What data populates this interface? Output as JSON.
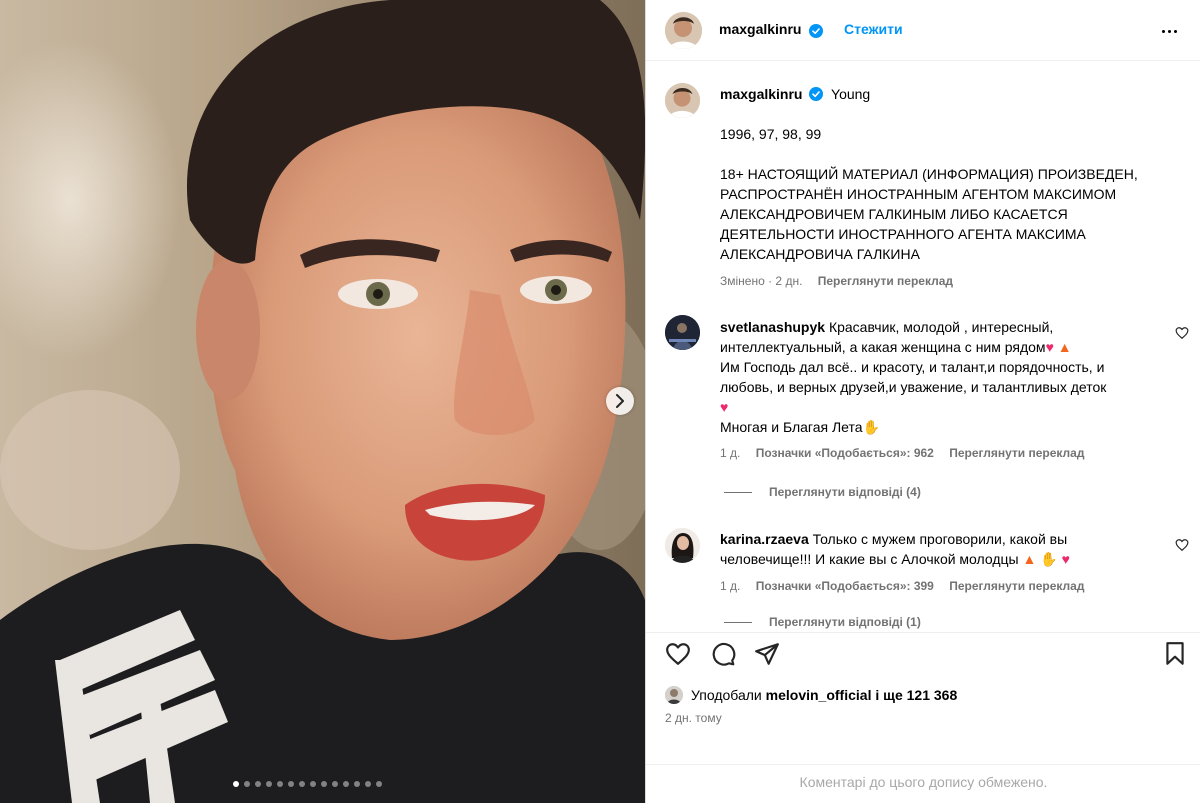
{
  "header": {
    "username": "maxgalkinru",
    "follow_label": "Стежити"
  },
  "caption": {
    "username": "maxgalkinru",
    "first_line": "Young",
    "years": "1996, 97, 98, 99",
    "notice": "18+ НАСТОЯЩИЙ МАТЕРИАЛ (ИНФОРМАЦИЯ) ПРОИЗВЕДЕН, РАСПРОСТРАНЁН ИНОСТРАННЫМ АГЕНТОМ МАКСИМОМ АЛЕКСАНДРОВИЧЕМ ГАЛКИНЫМ ЛИБО КАСАЕТСЯ ДЕЯТЕЛЬНОСТИ ИНОСТРАННОГО АГЕНТА МАКСИМА АЛЕКСАНДРОВИЧА ГАЛКИНА",
    "edited": "Змінено · 2 дн.",
    "translate": "Переглянути переклад"
  },
  "comments": [
    {
      "username": "svetlanashupyk",
      "text_1": "Красавчик, молодой , интересный, интеллектуальный, а какая женщина с ним рядом",
      "text_2": "Им Господь дал всё.. и красоту, и талант,и порядочность, и любовь, и верных друзей,и уважение, и талантливых деток",
      "text_3": "Многая и Благая Лета",
      "time": "1 д.",
      "likes": "Позначки «Подобається»: 962",
      "translate": "Переглянути переклад",
      "replies": "Переглянути відповіді (4)"
    },
    {
      "username": "karina.rzaeva",
      "text_1": "Только с мужем проговорили, какой вы человечище!!! И какие вы с Алочкой молодцы",
      "time": "1 д.",
      "likes": "Позначки «Подобається»: 399",
      "translate": "Переглянути переклад",
      "replies": "Переглянути відповіді (1)"
    }
  ],
  "likes_line": {
    "prefix": "Уподобали",
    "user": "melovin_official",
    "suffix": "і ще 121 368"
  },
  "date": "2 дн. тому",
  "comments_limited": "Коментарі до цього допису обмежено.",
  "carousel": {
    "count": 14,
    "active": 0
  },
  "colors": {
    "accent": "#0095f6",
    "verified": "#0095f6",
    "muted": "#737373"
  },
  "icons": [
    "next-arrow-icon",
    "verified-icon",
    "more-icon",
    "heart-icon",
    "comment-icon",
    "share-icon",
    "bookmark-icon"
  ]
}
